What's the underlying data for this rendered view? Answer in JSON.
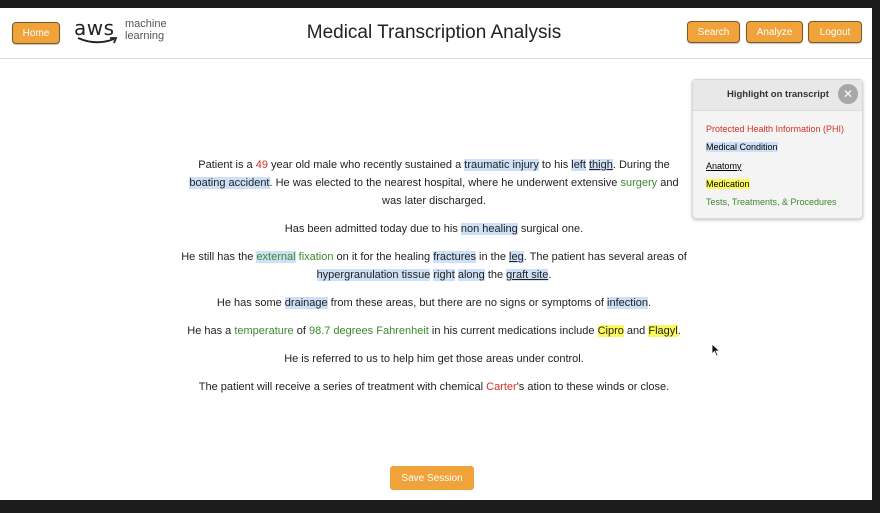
{
  "header": {
    "home_label": "Home",
    "logo_line1": "machine",
    "logo_line2": "learning",
    "logo_word": "aws",
    "title": "Medical Transcription Analysis",
    "search_label": "Search",
    "analyze_label": "Analyze",
    "logout_label": "Logout"
  },
  "panel": {
    "title": "Highlight on transcript",
    "close_glyph": "✕",
    "legend": {
      "phi": "Protected Health Information (PHI)",
      "condition": "Medical Condition",
      "anatomy": "Anatomy",
      "medication": "Medication",
      "tests": "Tests, Treatments, & Procedures"
    }
  },
  "transcript": {
    "p1": [
      {
        "t": "Patient is a "
      },
      {
        "t": "49",
        "c": "phi"
      },
      {
        "t": " year old male who recently sustained a "
      },
      {
        "t": "traumatic injury",
        "c": "cond"
      },
      {
        "t": " to his "
      },
      {
        "t": "left",
        "c": "cond"
      },
      {
        "t": " "
      },
      {
        "t": "thigh",
        "c": "cond anat"
      },
      {
        "t": ". During the "
      },
      {
        "t": "boating accident",
        "c": "cond"
      },
      {
        "t": ". He was elected to the nearest hospital, where he underwent extensive "
      },
      {
        "t": "surgery",
        "c": "test"
      },
      {
        "t": " and was later discharged."
      }
    ],
    "p2": [
      {
        "t": "Has been admitted today due to his "
      },
      {
        "t": "non healing",
        "c": "cond"
      },
      {
        "t": " surgical one."
      }
    ],
    "p3": [
      {
        "t": "He still has the "
      },
      {
        "t": "external",
        "c": "test cond"
      },
      {
        "t": " fixation",
        "c": "test"
      },
      {
        "t": " on it for the healing "
      },
      {
        "t": "fractures",
        "c": "cond"
      },
      {
        "t": " in the "
      },
      {
        "t": "leg",
        "c": "cond anat"
      },
      {
        "t": ". The patient has several areas of "
      },
      {
        "t": "hypergranulation tissue",
        "c": "cond"
      },
      {
        "t": " "
      },
      {
        "t": "right",
        "c": "cond"
      },
      {
        "t": " "
      },
      {
        "t": "along",
        "c": "cond"
      },
      {
        "t": " the "
      },
      {
        "t": "graft site",
        "c": "cond anat"
      },
      {
        "t": "."
      }
    ],
    "p4": [
      {
        "t": "He has some "
      },
      {
        "t": "drainage",
        "c": "cond"
      },
      {
        "t": " from these areas, but there are no signs or symptoms of "
      },
      {
        "t": "infection",
        "c": "cond"
      },
      {
        "t": "."
      }
    ],
    "p5": [
      {
        "t": "He has a "
      },
      {
        "t": "temperature",
        "c": "test"
      },
      {
        "t": " of "
      },
      {
        "t": "98.7 degrees Fahrenheit",
        "c": "test"
      },
      {
        "t": " in his current medications include "
      },
      {
        "t": "Cipro",
        "c": "med"
      },
      {
        "t": " and "
      },
      {
        "t": "Flagyl",
        "c": "med"
      },
      {
        "t": "."
      }
    ],
    "p6": [
      {
        "t": "He is referred to us to help him get those areas under control."
      }
    ],
    "p7": [
      {
        "t": "The patient will receive a series of treatment with chemical "
      },
      {
        "t": "Carter",
        "c": "phi"
      },
      {
        "t": "'s ation to these winds or close."
      }
    ]
  },
  "footer": {
    "save_label": "Save Session"
  },
  "colors": {
    "accent": "#f0a23b",
    "phi": "#d1312a",
    "condition_bg": "#cde0f7",
    "medication_bg": "#faf85a",
    "tests": "#3a8a2c"
  }
}
